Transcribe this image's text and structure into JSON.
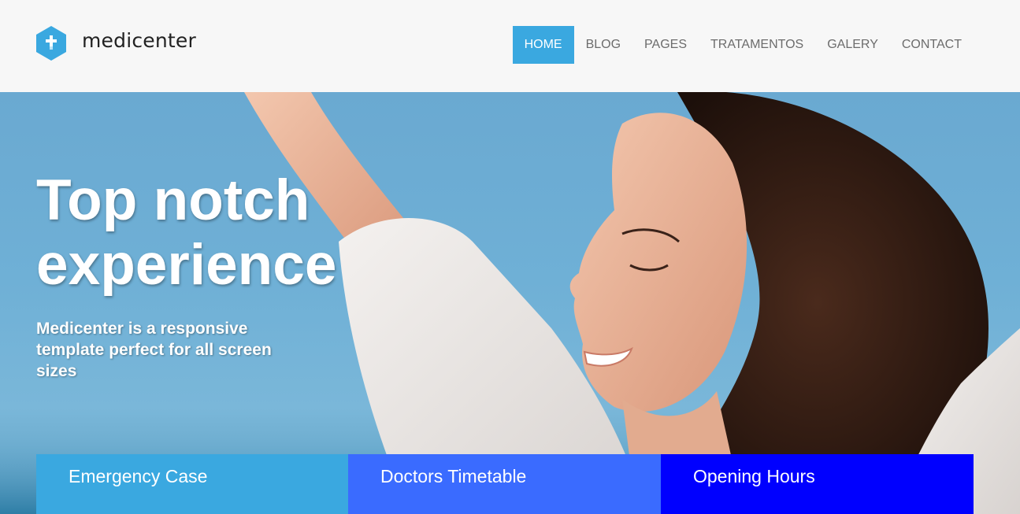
{
  "brand": {
    "name": "medicenter",
    "logo_icon": "hexagon-cross-icon",
    "accent_color": "#3aa8e0"
  },
  "nav": {
    "items": [
      {
        "label": "HOME",
        "active": true
      },
      {
        "label": "BLOG",
        "active": false
      },
      {
        "label": "PAGES",
        "active": false
      },
      {
        "label": "TRATAMENTOS",
        "active": false
      },
      {
        "label": "GALERY",
        "active": false
      },
      {
        "label": "CONTACT",
        "active": false
      }
    ]
  },
  "hero": {
    "title_line1": "Top notch",
    "title_line2": "experience",
    "subtitle": "Medicenter is a responsive template perfect for all screen sizes"
  },
  "boxes": [
    {
      "label": "Emergency Case",
      "color": "#3aa8e0"
    },
    {
      "label": "Doctors Timetable",
      "color": "#3a6bff"
    },
    {
      "label": "Opening Hours",
      "color": "#0000ff"
    }
  ]
}
